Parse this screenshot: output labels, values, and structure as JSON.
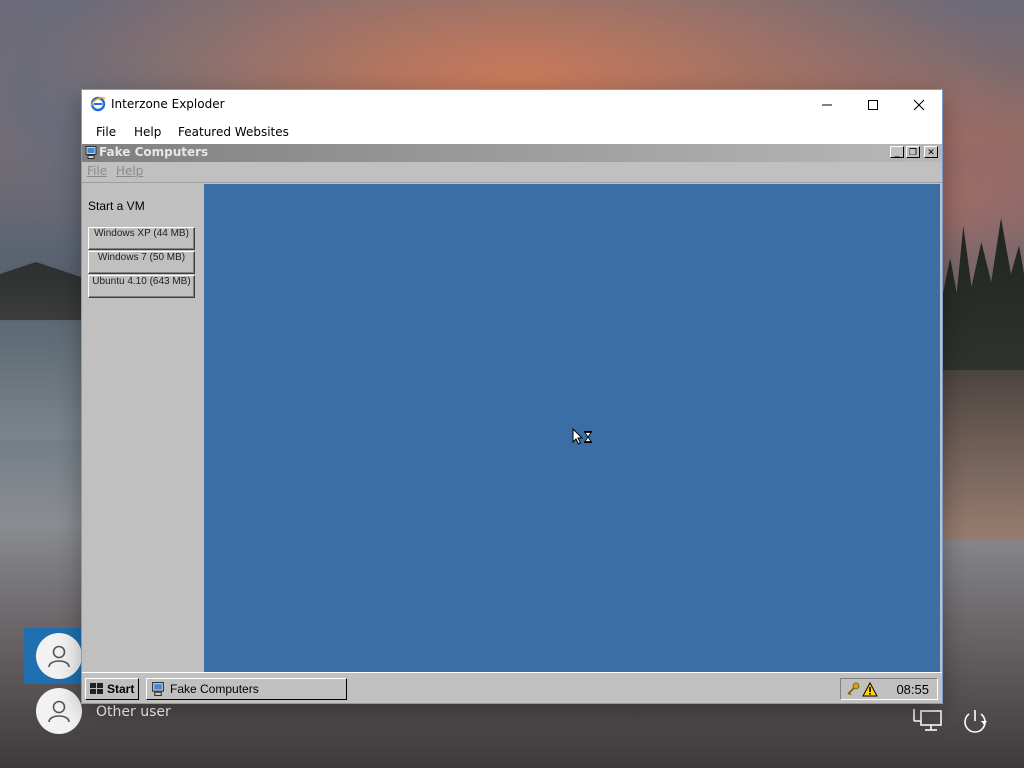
{
  "lock_screen": {
    "other_user_label": "Other user",
    "icons": [
      "user-icon",
      "network-icon",
      "power-icon"
    ]
  },
  "browser": {
    "title": "Interzone Exploder",
    "icon": "ie-logo-icon",
    "controls": {
      "minimize": "—",
      "maximize": "☐",
      "close": "✕"
    },
    "menu": {
      "file": "File",
      "help": "Help",
      "featured": "Featured Websites"
    }
  },
  "app": {
    "title": "Fake Computers",
    "controls": {
      "minimize": "_",
      "restore": "❐",
      "close": "✕"
    },
    "menu": {
      "file": "File",
      "help": "Help"
    },
    "sidebar": {
      "heading": "Start a VM",
      "buttons": [
        {
          "label": "Windows XP (44 MB)"
        },
        {
          "label": "Windows 7 (50 MB)"
        },
        {
          "label": "Ubuntu 4.10 (643 MB)"
        }
      ]
    },
    "desktop_color": "#3a6ea5",
    "taskbar": {
      "start_label": "Start",
      "task_label": "Fake Computers",
      "clock": "08:55",
      "tray_icons": [
        "key-icon",
        "warning-icon"
      ]
    }
  },
  "colors": {
    "desktop": "#3a6ea5",
    "win95_face": "#c0c0c0",
    "lock_tile": "#1f6fb0"
  }
}
